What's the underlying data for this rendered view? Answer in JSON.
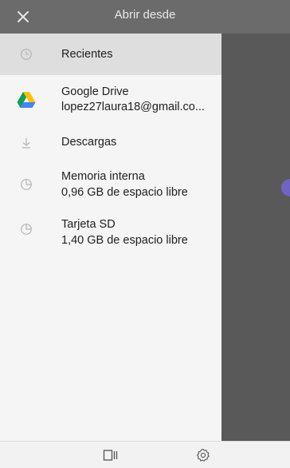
{
  "header": {
    "title": "Abrir desde",
    "close_icon": "close-icon"
  },
  "drawer": {
    "items": [
      {
        "label": "Recientes",
        "icon": "clock-icon",
        "selected": true
      },
      {
        "label": "Google Drive",
        "sub": "lopez27laura18@gmail.co...",
        "icon": "google-drive-icon"
      },
      {
        "label": "Descargas",
        "icon": "download-icon"
      },
      {
        "label": "Memoria interna",
        "sub": "0,96 GB de espacio libre",
        "icon": "storage-pie-icon"
      },
      {
        "label": "Tarjeta SD",
        "sub": "1,40 GB de espacio libre",
        "icon": "storage-pie-icon"
      }
    ]
  },
  "bottom_bar": {
    "left_icon": "view-toggle-icon",
    "right_icon": "settings-icon"
  },
  "colors": {
    "topbar": "#6b6b6b",
    "drawer": "#f5f5f5",
    "overlay": "#595959",
    "selected": "#dedede",
    "accent_edge": "#6f63c4"
  }
}
